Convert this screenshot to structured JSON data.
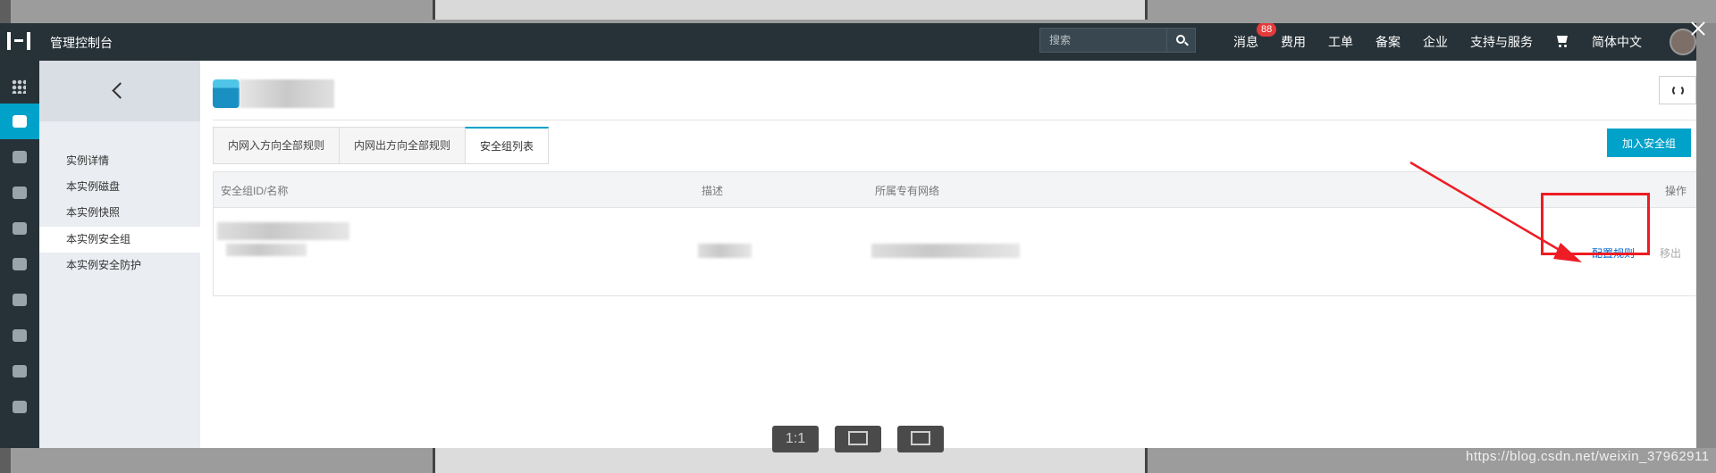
{
  "app": {
    "title": "管理控制台"
  },
  "search": {
    "placeholder": "搜索"
  },
  "nav": {
    "messages": "消息",
    "messages_badge": "88",
    "fees": "费用",
    "tickets": "工单",
    "filing": "备案",
    "enterprise": "企业",
    "support": "支持与服务",
    "language": "简体中文"
  },
  "sidebar": {
    "items": [
      {
        "label": "实例详情"
      },
      {
        "label": "本实例磁盘"
      },
      {
        "label": "本实例快照"
      },
      {
        "label": "本实例安全组"
      },
      {
        "label": "本实例安全防护"
      }
    ]
  },
  "tabs": [
    {
      "label": "内网入方向全部规则"
    },
    {
      "label": "内网出方向全部规则"
    },
    {
      "label": "安全组列表"
    }
  ],
  "actions": {
    "add_security_group": "加入安全组"
  },
  "table": {
    "headers": {
      "id_name": "安全组ID/名称",
      "description": "描述",
      "vpc": "所属专有网络",
      "operations": "操作"
    },
    "row": {
      "configure_rules": "配置规则",
      "remove": "移出"
    }
  },
  "viewer": {
    "zoom_label": "1:1"
  },
  "watermark": "https://blog.csdn.net/weixin_37962911",
  "colors": {
    "accent": "#00a2ca",
    "topbar": "#263238",
    "link": "#0066cc",
    "annotation": "#ee1c24"
  }
}
